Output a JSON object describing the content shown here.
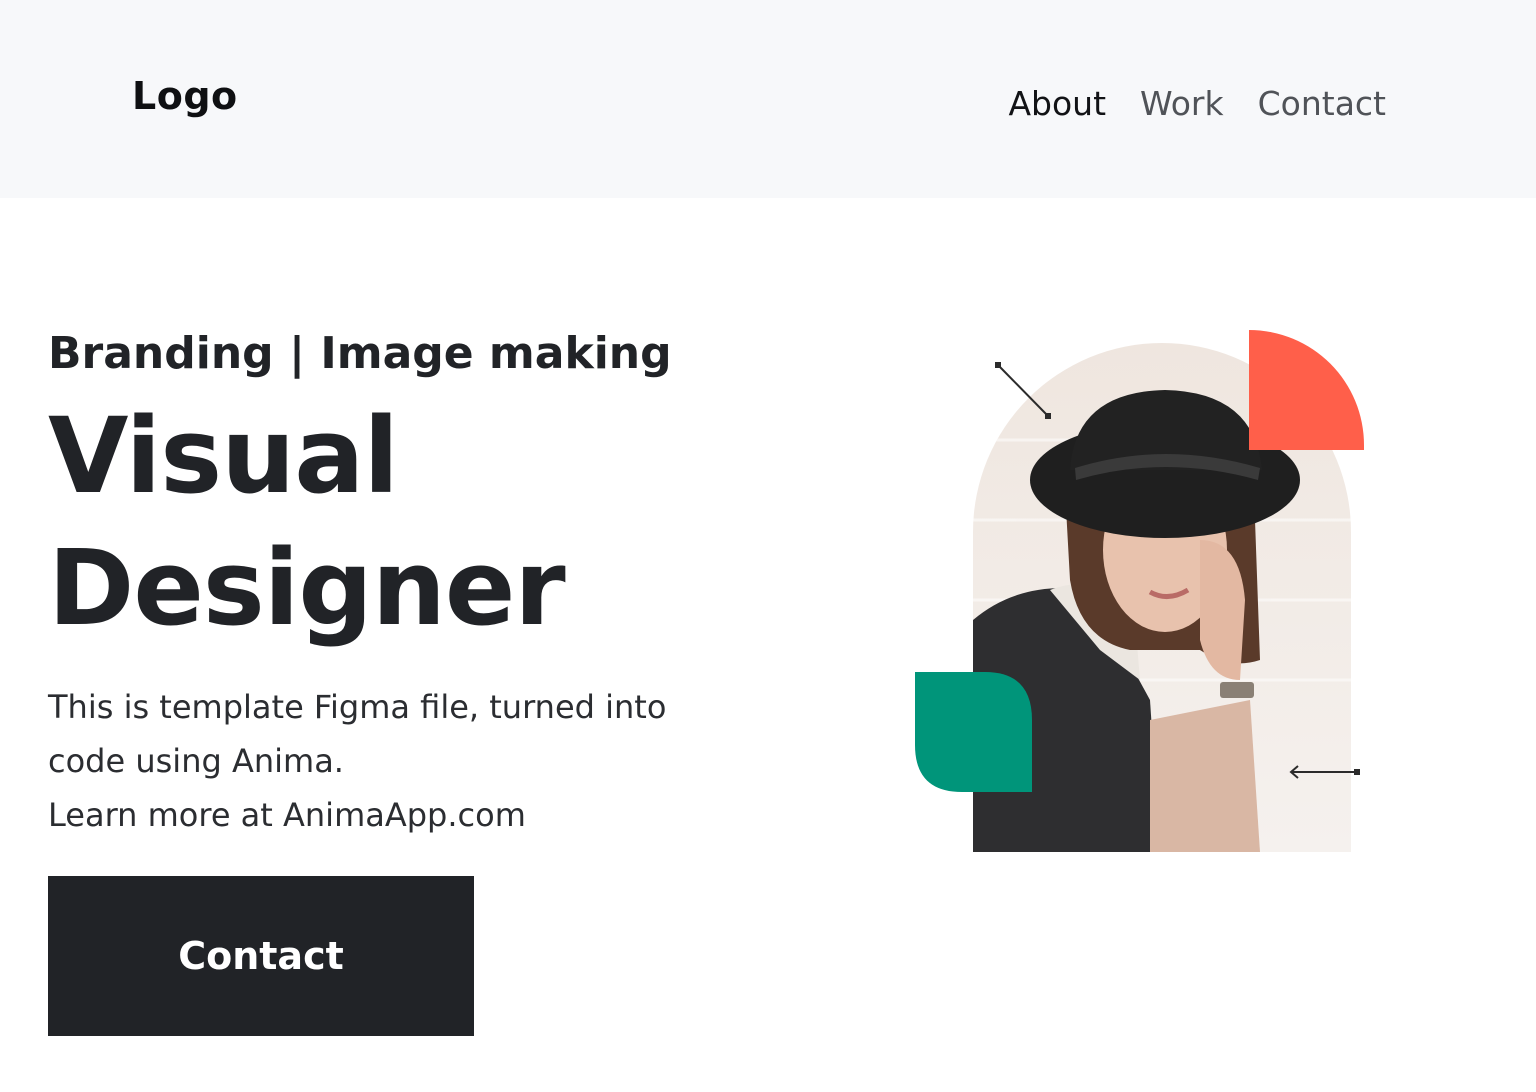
{
  "header": {
    "logo": "Logo",
    "nav": [
      {
        "label": "About"
      },
      {
        "label": "Work"
      },
      {
        "label": "Contact"
      }
    ]
  },
  "hero": {
    "subtitle": "Branding | Image making",
    "title_line1": "Visual",
    "title_line2": "Designer",
    "description_line1": "This is template Figma file, turned into code using Anima.",
    "description_line2": "Learn more at AnimaApp.com",
    "cta_label": "Contact"
  },
  "colors": {
    "header_bg": "#f7f8fa",
    "text_dark": "#212327",
    "button_bg": "#212327",
    "accent_coral": "#ff5f4a",
    "accent_green": "#00957a"
  }
}
